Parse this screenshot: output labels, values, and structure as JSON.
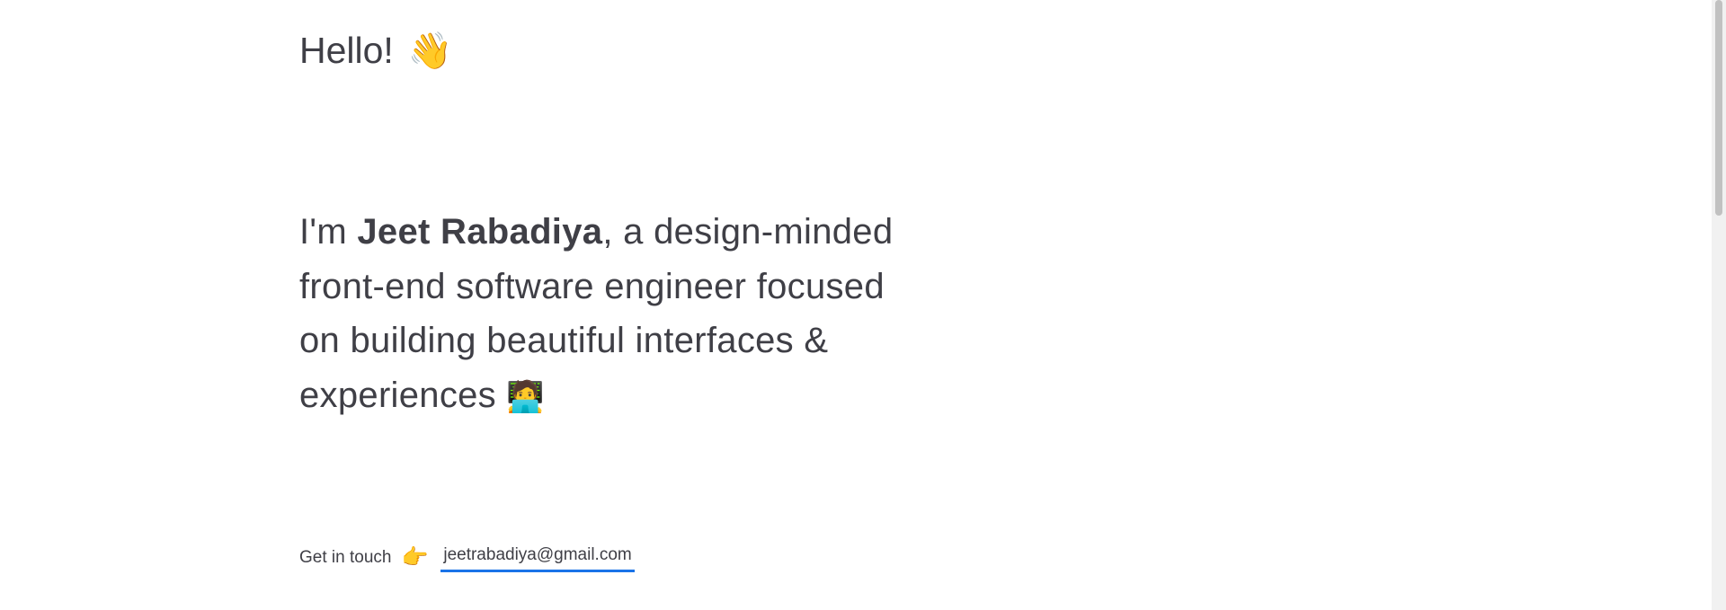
{
  "greeting": {
    "text": "Hello!",
    "emoji": "👋"
  },
  "intro": {
    "prefix": "I'm ",
    "name": "Jeet Rabadiya",
    "description": ", a design-minded front-end software engineer focused on building beautiful interfaces & experiences ",
    "emoji": "🧑‍💻"
  },
  "contact": {
    "label": "Get in touch",
    "emoji": "👉",
    "email": "jeetrabadiya@gmail.com"
  },
  "colors": {
    "text": "#3f3f46",
    "link_underline": "#1a73e8",
    "background": "#ffffff"
  },
  "icons": {
    "wave": "waving-hand-icon",
    "technologist": "technologist-icon",
    "pointing": "pointing-right-icon"
  }
}
